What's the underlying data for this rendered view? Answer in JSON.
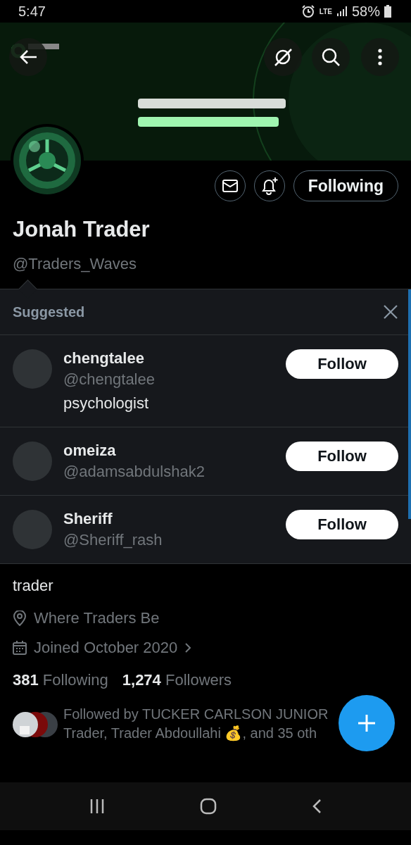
{
  "status_bar": {
    "time": "5:47",
    "network": "LTE",
    "battery": "58%"
  },
  "profile": {
    "name": "Jonah Trader",
    "handle": "@Traders_Waves",
    "follow_button": "Following"
  },
  "suggested": {
    "title": "Suggested",
    "users": [
      {
        "name": "chengtalee",
        "handle": "@chengtalee",
        "bio": "psychologist",
        "button": "Follow"
      },
      {
        "name": "omeiza",
        "handle": "@adamsabdulshak2",
        "button": "Follow"
      },
      {
        "name": "Sheriff",
        "handle": "@Sheriff_rash",
        "button": "Follow"
      }
    ]
  },
  "bio": {
    "text": "trader",
    "location": "Where Traders Be",
    "joined": "Joined October 2020",
    "following_count": "381",
    "following_label": "Following",
    "followers_count": "1,274",
    "followers_label": "Followers",
    "followed_by": [
      "Followed by TUCKER CARLSON JUNIOR",
      "Trader, Trader Abdoullahi 💰, and 35 oth"
    ]
  }
}
